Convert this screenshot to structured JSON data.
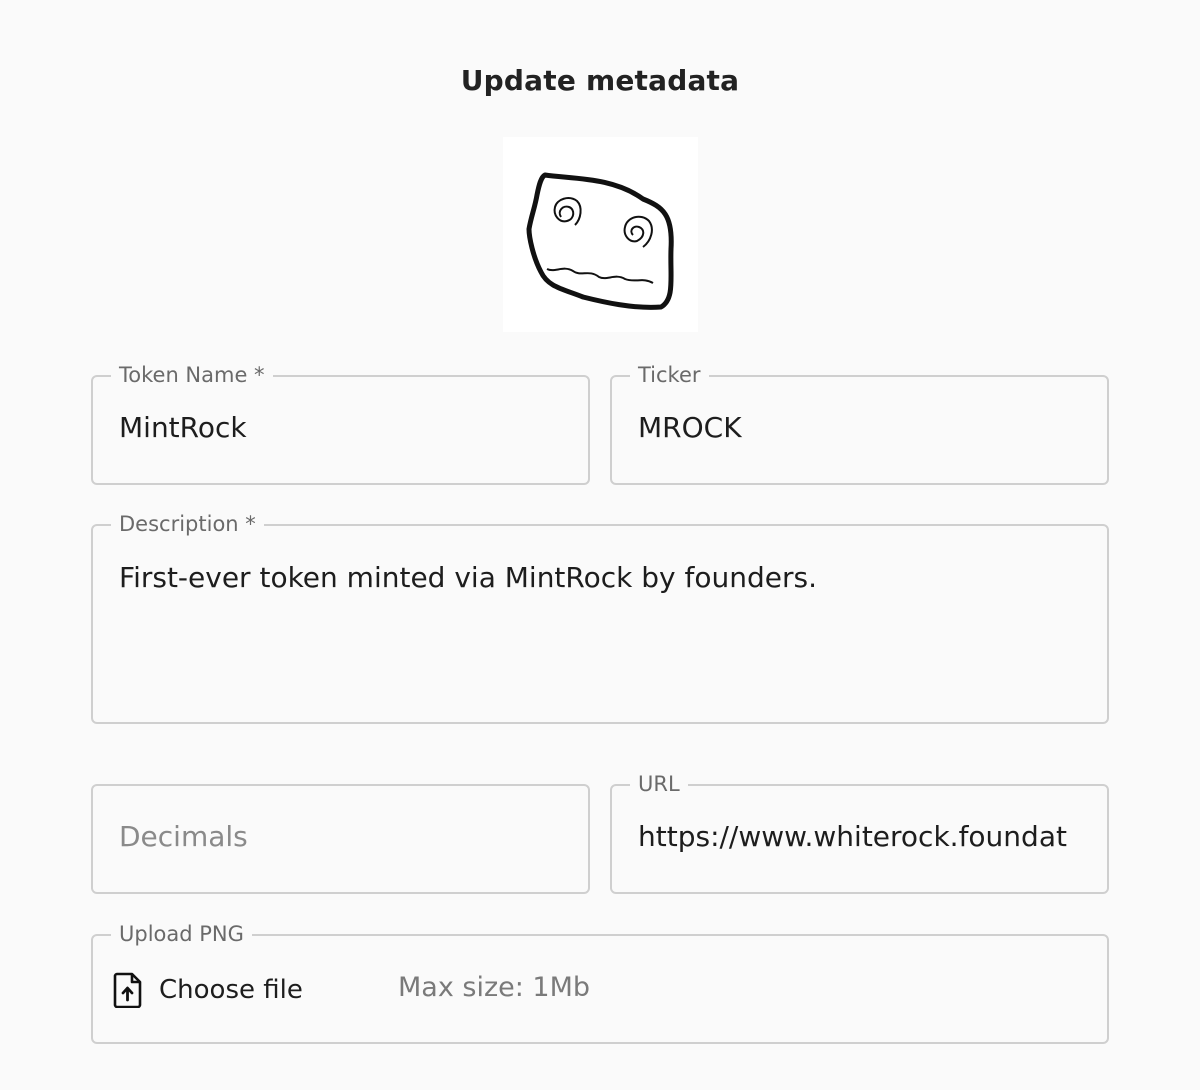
{
  "header": {
    "title": "Update metadata"
  },
  "token_image": {
    "icon": "rock-doodle-icon"
  },
  "form": {
    "token_name": {
      "label": "Token Name *",
      "value": "MintRock"
    },
    "ticker": {
      "label": "Ticker",
      "value": "MROCK"
    },
    "description": {
      "label": "Description *",
      "value": "First-ever token minted via MintRock by founders."
    },
    "decimals": {
      "label": "",
      "placeholder": "Decimals",
      "value": ""
    },
    "url": {
      "label": "URL",
      "value": "https://www.whiterock.foundat"
    },
    "upload": {
      "label": "Upload PNG",
      "button_label": "Choose file",
      "hint": "Max size: 1Mb",
      "icon": "file-upload-icon"
    }
  },
  "colors": {
    "background": "#fafafa",
    "border": "#cfcfcf",
    "text": "#1d1d1d",
    "label": "#6a6a6a"
  }
}
